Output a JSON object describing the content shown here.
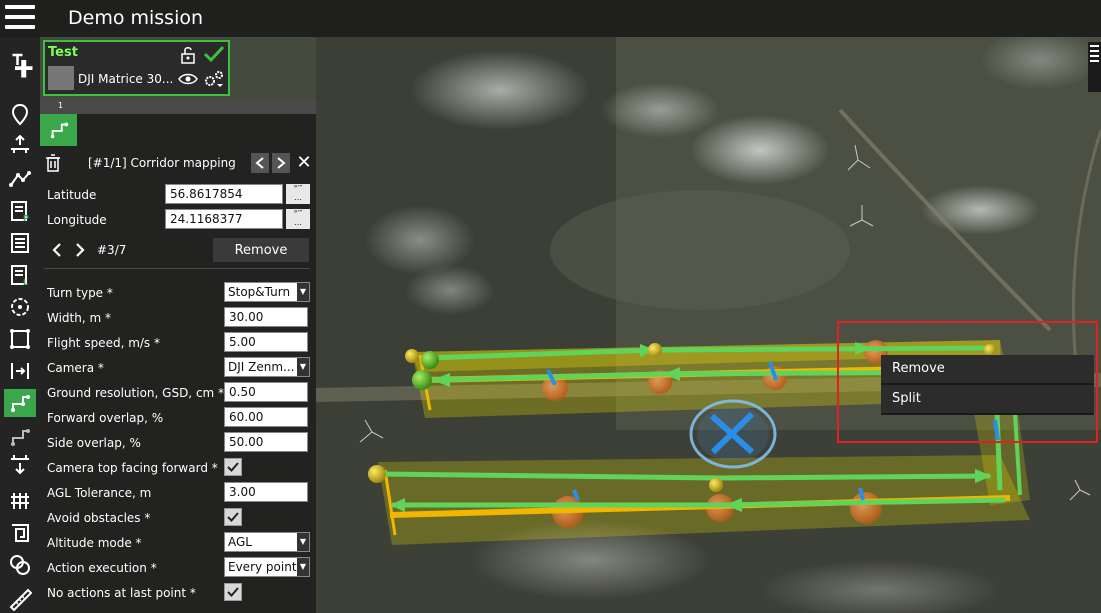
{
  "app": {
    "title": "Demo mission"
  },
  "vehicle": {
    "name": "Test",
    "model": "DJI Matrice 30..."
  },
  "route": {
    "waypoint_number": "1"
  },
  "panel": {
    "title": "[#1/1] Corridor mapping",
    "latitude_label": "Latitude",
    "latitude_value": "56.8617854",
    "longitude_label": "Longitude",
    "longitude_value": "24.1168377",
    "point_counter": "#3/7",
    "remove_label": "Remove",
    "fields": [
      {
        "label": "Turn type *",
        "value": "Stop&Turn",
        "kind": "select"
      },
      {
        "label": "Width, m *",
        "value": "30.00",
        "kind": "input"
      },
      {
        "label": "Flight speed, m/s *",
        "value": "5.00",
        "kind": "input"
      },
      {
        "label": "Camera *",
        "value": "DJI Zenm...",
        "kind": "select"
      },
      {
        "label": "Ground resolution, GSD, cm *",
        "value": "0.50",
        "kind": "input"
      },
      {
        "label": "Forward overlap, %",
        "value": "60.00",
        "kind": "input"
      },
      {
        "label": "Side overlap, %",
        "value": "50.00",
        "kind": "input"
      },
      {
        "label": "Camera top facing forward *",
        "value": "true",
        "kind": "check"
      },
      {
        "label": "AGL Tolerance, m",
        "value": "3.00",
        "kind": "input"
      },
      {
        "label": "Avoid obstacles *",
        "value": "true",
        "kind": "check"
      },
      {
        "label": "Altitude mode *",
        "value": "AGL",
        "kind": "select"
      },
      {
        "label": "Action execution *",
        "value": "Every point",
        "kind": "select"
      },
      {
        "label": "No actions at last point *",
        "value": "true",
        "kind": "check"
      }
    ]
  },
  "context_menu": {
    "items": [
      "Remove",
      "Split"
    ]
  },
  "colors": {
    "accent": "#3aa84a",
    "vehicle_name": "#7dff58",
    "highlight": "#e32020",
    "route_green": "#5fd35a",
    "route_yellow": "#f2b600"
  }
}
